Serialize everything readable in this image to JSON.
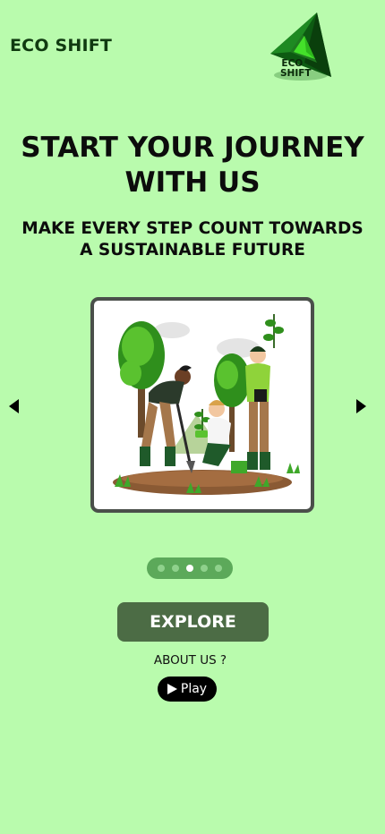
{
  "brand": {
    "name": "ECO SHIFT"
  },
  "logo": {
    "line1": "ECO",
    "line2": "SHIFT",
    "icon": "recycle-triangle-logo"
  },
  "hero": {
    "title_line1": "START YOUR JOURNEY",
    "title_line2": "WITH US",
    "subtitle_line1": "MAKE EVERY STEP COUNT TOWARDS",
    "subtitle_line2": "A SUSTAINABLE FUTURE"
  },
  "carousel": {
    "image": "tree-planting-illustration",
    "prev_icon": "triangle-left-icon",
    "next_icon": "triangle-right-icon",
    "slide_count": 5,
    "active_index": 2
  },
  "actions": {
    "explore_label": "EXPLORE",
    "about_label": "ABOUT US ?",
    "play_label": "Play",
    "play_icon": "play-icon"
  },
  "colors": {
    "background": "#b9fbad",
    "primary_button": "#4c6c45",
    "dots_pill": "#5ca95a",
    "card_border": "#4a4f4a"
  }
}
